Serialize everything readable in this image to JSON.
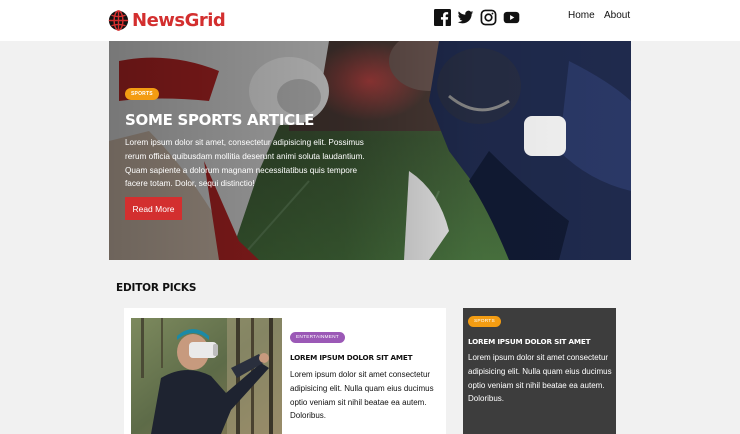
{
  "header": {
    "logo_text": "NewsGrid",
    "icons": [
      "globe-icon",
      "facebook-icon",
      "twitter-icon",
      "instagram-icon",
      "youtube-icon"
    ],
    "nav": [
      {
        "label": "Home"
      },
      {
        "label": "About"
      }
    ]
  },
  "hero": {
    "badge": "SPORTS",
    "title": "SOME SPORTS ARTICLE",
    "text": "Lorem ipsum dolor sit amet, consectetur adipisicing elit. Possimus rerum officia quibusdam mollitia deserunt animi soluta laudantium. Quam sapiente a dolorum magnam necessitatibus quis tempore facere totam. Dolor, sequi distinctio!",
    "button": "Read More"
  },
  "editor_picks": {
    "heading": "EDITOR PICKS",
    "cards": [
      {
        "badge": "ENTERTAINMENT",
        "title": "LOREM IPSUM DOLOR SIT AMET",
        "text": "Lorem ipsum dolor sit amet consectetur adipisicing elit. Nulla quam eius ducimus optio veniam sit nihil beatae ea autem. Doloribus."
      },
      {
        "badge": "SPORTS",
        "title": "LOREM IPSUM DOLOR SIT AMET",
        "text": "Lorem ipsum dolor sit amet consectetur adipisicing elit. Nulla quam eius ducimus optio veniam sit nihil beatae ea autem. Doloribus."
      }
    ]
  },
  "colors": {
    "brand_red": "#d32f2f",
    "sports_orange": "#f39c12",
    "entertainment_purple": "#9b59b6",
    "dark_card": "#3d3d3d"
  }
}
